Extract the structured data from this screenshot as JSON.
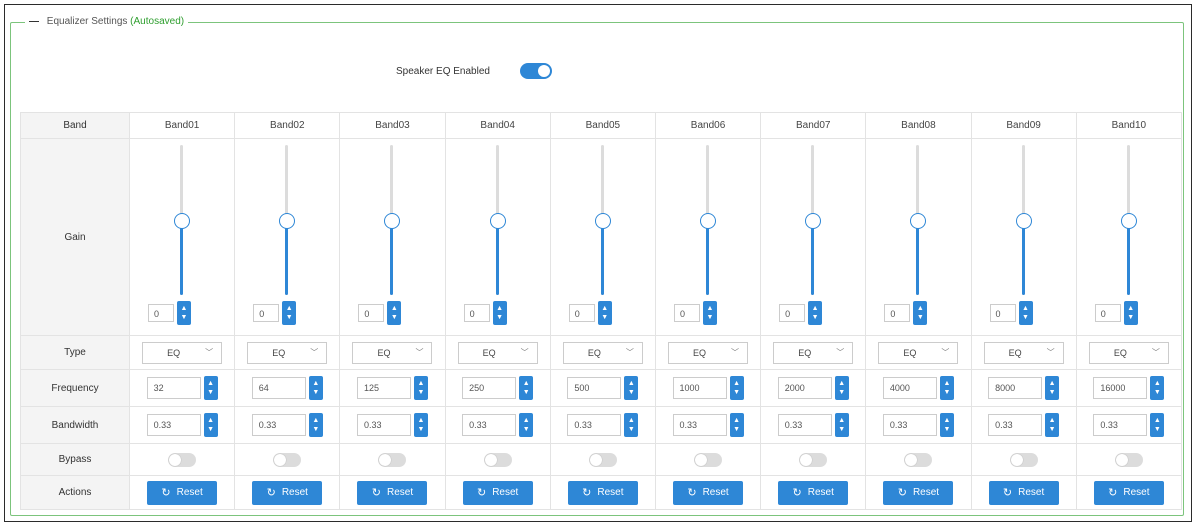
{
  "section": {
    "title": "Equalizer Settings",
    "status": "(Autosaved)",
    "collapse_symbol": "—"
  },
  "speaker_eq": {
    "label": "Speaker EQ Enabled",
    "enabled": true
  },
  "row_labels": {
    "band": "Band",
    "gain": "Gain",
    "type": "Type",
    "frequency": "Frequency",
    "bandwidth": "Bandwidth",
    "bypass": "Bypass",
    "actions": "Actions"
  },
  "reset_label": "Reset",
  "icons": {
    "spin_up": "▲",
    "spin_down": "▼",
    "select_chevron": "﹀",
    "reset": "↻"
  },
  "colors": {
    "accent": "#2e87d6",
    "autosaved": "#2e9e2e",
    "fieldset_border": "#7cc47c"
  },
  "gain_range": [
    -12,
    12
  ],
  "bands": [
    {
      "name": "Band01",
      "gain": "0",
      "type": "EQ",
      "frequency": "32",
      "bandwidth": "0.33",
      "bypass": false
    },
    {
      "name": "Band02",
      "gain": "0",
      "type": "EQ",
      "frequency": "64",
      "bandwidth": "0.33",
      "bypass": false
    },
    {
      "name": "Band03",
      "gain": "0",
      "type": "EQ",
      "frequency": "125",
      "bandwidth": "0.33",
      "bypass": false
    },
    {
      "name": "Band04",
      "gain": "0",
      "type": "EQ",
      "frequency": "250",
      "bandwidth": "0.33",
      "bypass": false
    },
    {
      "name": "Band05",
      "gain": "0",
      "type": "EQ",
      "frequency": "500",
      "bandwidth": "0.33",
      "bypass": false
    },
    {
      "name": "Band06",
      "gain": "0",
      "type": "EQ",
      "frequency": "1000",
      "bandwidth": "0.33",
      "bypass": false
    },
    {
      "name": "Band07",
      "gain": "0",
      "type": "EQ",
      "frequency": "2000",
      "bandwidth": "0.33",
      "bypass": false
    },
    {
      "name": "Band08",
      "gain": "0",
      "type": "EQ",
      "frequency": "4000",
      "bandwidth": "0.33",
      "bypass": false
    },
    {
      "name": "Band09",
      "gain": "0",
      "type": "EQ",
      "frequency": "8000",
      "bandwidth": "0.33",
      "bypass": false
    },
    {
      "name": "Band10",
      "gain": "0",
      "type": "EQ",
      "frequency": "16000",
      "bandwidth": "0.33",
      "bypass": false
    }
  ]
}
